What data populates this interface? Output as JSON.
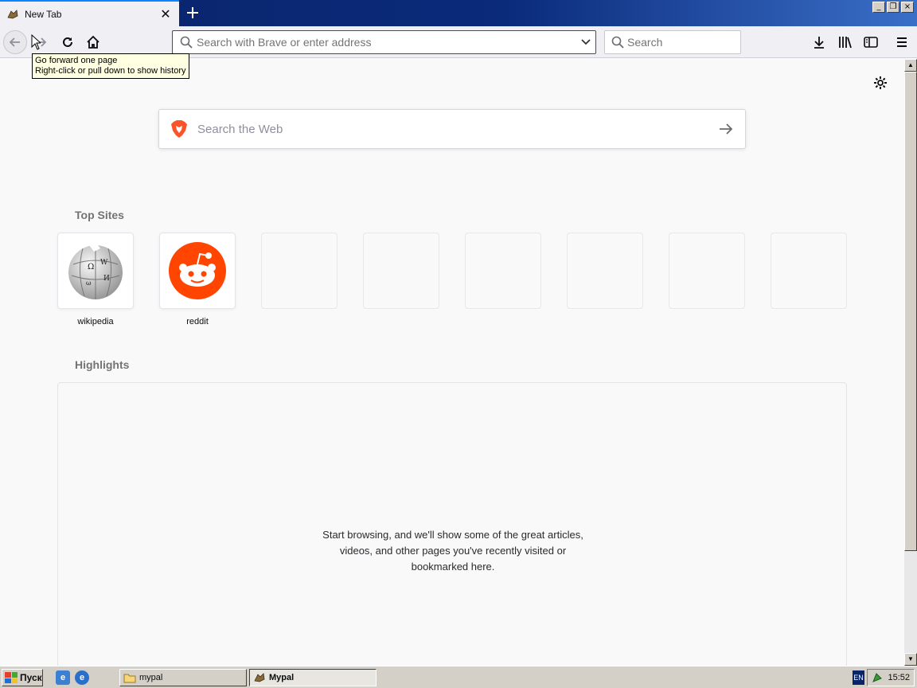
{
  "tab": {
    "title": "New Tab",
    "favicon": "mypal-icon"
  },
  "window_controls": {
    "minimize": "_",
    "restore": "❐",
    "close": "×"
  },
  "navbar": {
    "url_placeholder": "Search with Brave or enter address",
    "search_placeholder": "Search"
  },
  "tooltip": {
    "line1": "Go forward one page",
    "line2": "Right-click or pull down to show history"
  },
  "newtab": {
    "web_search_placeholder": "Search the Web",
    "top_sites_title": "Top Sites",
    "top_sites": [
      {
        "label": "wikipedia",
        "icon": "wikipedia-globe-icon"
      },
      {
        "label": "reddit",
        "icon": "reddit-alien-icon"
      },
      {
        "label": ""
      },
      {
        "label": ""
      },
      {
        "label": ""
      },
      {
        "label": ""
      },
      {
        "label": ""
      },
      {
        "label": ""
      }
    ],
    "highlights_title": "Highlights",
    "highlights_message": [
      "Start browsing, and we'll show some of the great articles,",
      "videos, and other pages you've recently visited or",
      "bookmarked here."
    ]
  },
  "taskbar": {
    "start_label": "Пуск",
    "tasks": [
      {
        "label": "mypal",
        "icon": "folder-icon"
      },
      {
        "label": "Mypal",
        "icon": "mypal-icon"
      }
    ],
    "language": "EN",
    "clock": "15:52"
  },
  "colors": {
    "accent": "#0a84ff",
    "reddit": "#ff4500",
    "brave": "#fb542b",
    "titlebar": "#0a246a"
  }
}
